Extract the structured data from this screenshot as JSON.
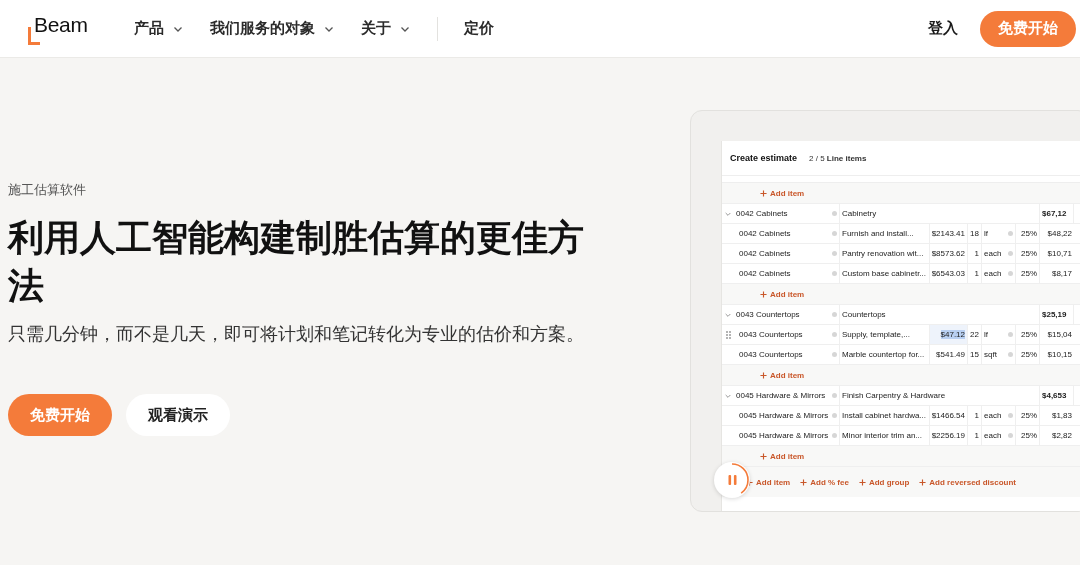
{
  "nav": {
    "logo": "Beam",
    "items": [
      {
        "label": "产品",
        "dropdown": true
      },
      {
        "label": "我们服务的对象",
        "dropdown": true
      },
      {
        "label": "关于",
        "dropdown": true
      },
      {
        "label": "定价",
        "dropdown": false
      }
    ],
    "login": "登入",
    "cta": "免费开始"
  },
  "hero": {
    "eyebrow": "施工估算软件",
    "title": "利用人工智能构建制胜估算的更佳方法",
    "subtitle": "只需几分钟，而不是几天，即可将计划和笔记转化为专业的估价和方案。",
    "buttons": [
      {
        "label": "免费开始",
        "kind": "primary"
      },
      {
        "label": "观看演示",
        "kind": "secondary"
      }
    ]
  },
  "estimate": {
    "title": "Create estimate",
    "counter": "2 / 5",
    "counter_label": "Line items",
    "top_add": "Add item",
    "groups": [
      {
        "code": "0042 Cabinets",
        "category": "Cabinetry",
        "total": "$67,12",
        "expanded": true,
        "add": "Add item",
        "items": [
          {
            "code": "0042 Cabinets",
            "description": "Furnish and install...",
            "price": "$2143.41",
            "qty": "18",
            "unit": "lf",
            "markup": "25%",
            "total": "$48,22",
            "selected": false
          },
          {
            "code": "0042 Cabinets",
            "description": "Pantry renovation wit...",
            "price": "$8573.62",
            "qty": "1",
            "unit": "each",
            "markup": "25%",
            "total": "$10,71",
            "selected": false
          },
          {
            "code": "0042 Cabinets",
            "description": "Custom base cabinetr...",
            "price": "$6543.03",
            "qty": "1",
            "unit": "each",
            "markup": "25%",
            "total": "$8,17",
            "selected": false
          }
        ]
      },
      {
        "code": "0043 Countertops",
        "category": "Countertops",
        "total": "$25,19",
        "expanded": true,
        "add": "Add item",
        "items": [
          {
            "code": "0043 Countertops",
            "description": "Supply, template,...",
            "price": "$47.12",
            "qty": "22",
            "unit": "lf",
            "markup": "25%",
            "total": "$15,04",
            "selected": true
          },
          {
            "code": "0043 Countertops",
            "description": "Marble countertop for...",
            "price": "$541.49",
            "qty": "15",
            "unit": "sqft",
            "markup": "25%",
            "total": "$10,15",
            "selected": false
          }
        ]
      },
      {
        "code": "0045 Hardware & Mirrors",
        "category": "Finish Carpentry & Hardware",
        "total": "$4,653",
        "expanded": true,
        "add": "Add item",
        "items": [
          {
            "code": "0045 Hardware & Mirrors",
            "description": "Install cabinet hardwa...",
            "price": "$1466.54",
            "qty": "1",
            "unit": "each",
            "markup": "25%",
            "total": "$1,83",
            "selected": false
          },
          {
            "code": "0045 Hardware & Mirrors",
            "description": "Minor interior trim an...",
            "price": "$2256.19",
            "qty": "1",
            "unit": "each",
            "markup": "25%",
            "total": "$2,82",
            "selected": false
          }
        ]
      }
    ],
    "actions": [
      "Add item",
      "Add % fee",
      "Add group",
      "Add reversed discount"
    ]
  }
}
